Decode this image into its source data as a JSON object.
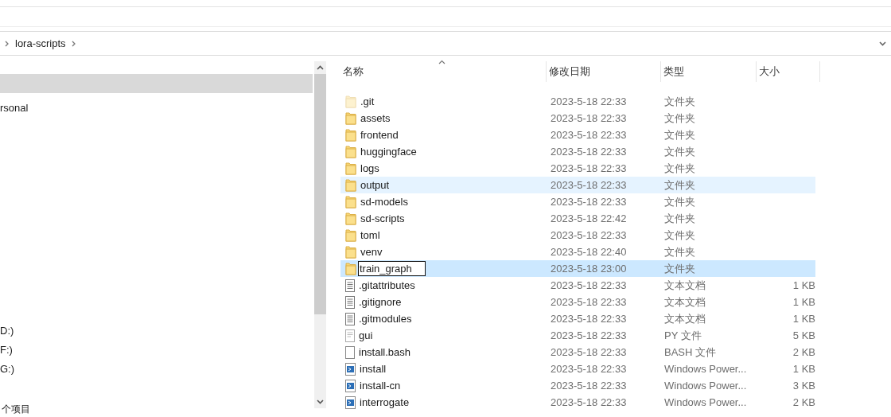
{
  "address_bar": {
    "crumbs": [
      "lora-scripts"
    ]
  },
  "nav_pane": {
    "items": [
      {
        "selected": true
      },
      {
        "label": "rsonal",
        "selected": false
      },
      {
        "label": "D:)",
        "selected": false
      },
      {
        "label": "F:)",
        "selected": false
      },
      {
        "label": "G:)",
        "selected": false
      }
    ]
  },
  "file_list": {
    "columns": [
      "名称",
      "修改日期",
      "类型",
      "大小"
    ],
    "rows": [
      {
        "name": ".git",
        "date": "2023-5-18 22:33",
        "type": "文件夹",
        "kind": "hidden-folder",
        "selected": false,
        "hovered": false
      },
      {
        "name": "assets",
        "date": "2023-5-18 22:33",
        "type": "文件夹",
        "kind": "folder",
        "selected": false,
        "hovered": false
      },
      {
        "name": "frontend",
        "date": "2023-5-18 22:33",
        "type": "文件夹",
        "kind": "folder",
        "selected": false,
        "hovered": false
      },
      {
        "name": "huggingface",
        "date": "2023-5-18 22:33",
        "type": "文件夹",
        "kind": "folder",
        "selected": false,
        "hovered": false
      },
      {
        "name": "logs",
        "date": "2023-5-18 22:33",
        "type": "文件夹",
        "kind": "folder",
        "selected": false,
        "hovered": false
      },
      {
        "name": "output",
        "date": "2023-5-18 22:33",
        "type": "文件夹",
        "kind": "folder",
        "selected": false,
        "hovered": true
      },
      {
        "name": "sd-models",
        "date": "2023-5-18 22:33",
        "type": "文件夹",
        "kind": "folder",
        "selected": false,
        "hovered": false
      },
      {
        "name": "sd-scripts",
        "date": "2023-5-18 22:42",
        "type": "文件夹",
        "kind": "folder",
        "selected": false,
        "hovered": false
      },
      {
        "name": "toml",
        "date": "2023-5-18 22:33",
        "type": "文件夹",
        "kind": "folder",
        "selected": false,
        "hovered": false
      },
      {
        "name": "venv",
        "date": "2023-5-18 22:40",
        "type": "文件夹",
        "kind": "folder",
        "selected": false,
        "hovered": false
      },
      {
        "name": "train_graph",
        "date": "2023-5-18 23:00",
        "type": "文件夹",
        "kind": "folder",
        "selected": true,
        "hovered": false,
        "editing": true
      },
      {
        "name": ".gitattributes",
        "date": "2023-5-18 22:33",
        "type": "文本文档",
        "size": "1 KB",
        "kind": "text",
        "selected": false,
        "hovered": false
      },
      {
        "name": ".gitignore",
        "date": "2023-5-18 22:33",
        "type": "文本文档",
        "size": "1 KB",
        "kind": "text",
        "selected": false,
        "hovered": false
      },
      {
        "name": ".gitmodules",
        "date": "2023-5-18 22:33",
        "type": "文本文档",
        "size": "1 KB",
        "kind": "text",
        "selected": false,
        "hovered": false
      },
      {
        "name": "gui",
        "date": "2023-5-18 22:33",
        "type": "PY 文件",
        "size": "5 KB",
        "kind": "python",
        "selected": false,
        "hovered": false
      },
      {
        "name": "install.bash",
        "date": "2023-5-18 22:33",
        "type": "BASH 文件",
        "size": "2 KB",
        "kind": "file",
        "selected": false,
        "hovered": false
      },
      {
        "name": "install",
        "date": "2023-5-18 22:33",
        "type": "Windows Power...",
        "size": "1 KB",
        "kind": "powershell",
        "selected": false,
        "hovered": false
      },
      {
        "name": "install-cn",
        "date": "2023-5-18 22:33",
        "type": "Windows Power...",
        "size": "3 KB",
        "kind": "powershell",
        "selected": false,
        "hovered": false
      },
      {
        "name": "interrogate",
        "date": "2023-5-18 22:33",
        "type": "Windows Power...",
        "size": "2 KB",
        "kind": "powershell",
        "selected": false,
        "hovered": false
      }
    ]
  },
  "status_bar": {
    "item_count": "个项目"
  }
}
